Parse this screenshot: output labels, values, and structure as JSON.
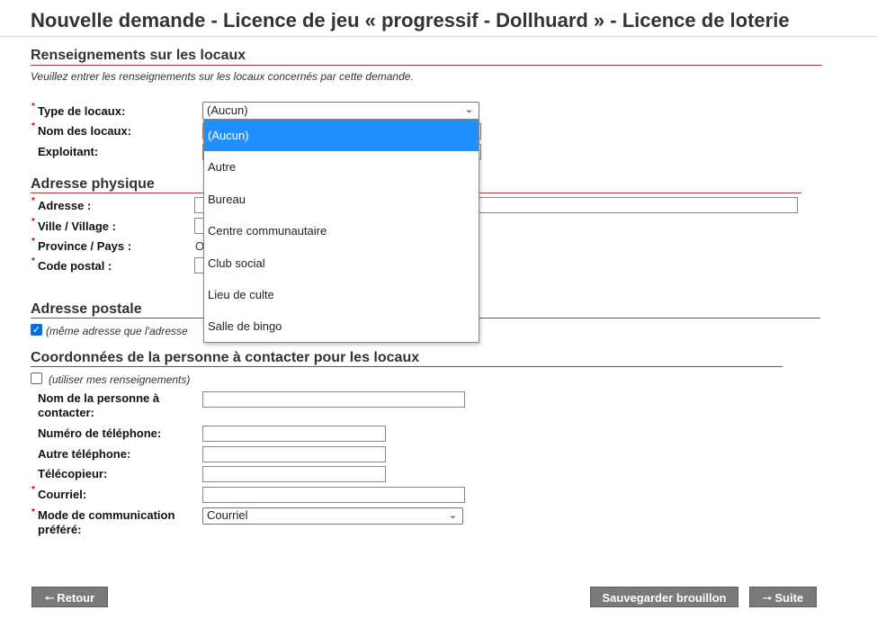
{
  "page": {
    "title": "Nouvelle demande - Licence de jeu « progressif - Dollhuard » - Licence de loterie"
  },
  "sections": {
    "locaux": {
      "title": "Renseignements sur les locaux",
      "intro": "Veuillez entrer les renseignements sur les locaux concernés par cette demande.",
      "type_label": "Type de locaux:",
      "type_value": "(Aucun)",
      "nom_label": "Nom des locaux:",
      "exploitant_label": "Exploitant:"
    },
    "adresse_physique": {
      "title": "Adresse physique",
      "adresse_label": "Adresse :",
      "ville_label": "Ville / Village :",
      "province_label": "Province / Pays :",
      "province_partial": "O",
      "code_label": "Code postal :"
    },
    "adresse_postale": {
      "title": "Adresse postale",
      "same_address_text": "(même adresse que l'adresse",
      "same_address_checked": true
    },
    "contact": {
      "title": "Coordonnées de la personne à contacter pour les locaux",
      "use_mine_text": "(utiliser mes renseignements)",
      "use_mine_checked": false,
      "nom_label": "Nom de la personne à contacter:",
      "tel_label": "Numéro de téléphone:",
      "autre_tel_label": "Autre téléphone:",
      "fax_label": "Télécopieur:",
      "courriel_label": "Courriel:",
      "mode_label": "Mode de communication préféré:",
      "mode_value": "Courriel"
    }
  },
  "dropdown": {
    "options": [
      "(Aucun)",
      "Autre",
      "Bureau",
      "Centre communautaire",
      "Club social",
      "Lieu de culte",
      "Salle de bingo"
    ],
    "selected_index": 0,
    "highlight_color": "#1e90ff"
  },
  "buttons": {
    "retour": "Retour",
    "sauvegarder": "Sauvegarder brouillon",
    "suite": "Suite"
  },
  "colors": {
    "section_rule": "#a33a3a",
    "required_marker": "#dd0000",
    "button_bg": "#7a7a7a"
  },
  "icons": {
    "required": "*",
    "chevron": "chevron-down-icon",
    "back": "arrow-left-icon",
    "next": "arrow-right-icon"
  }
}
